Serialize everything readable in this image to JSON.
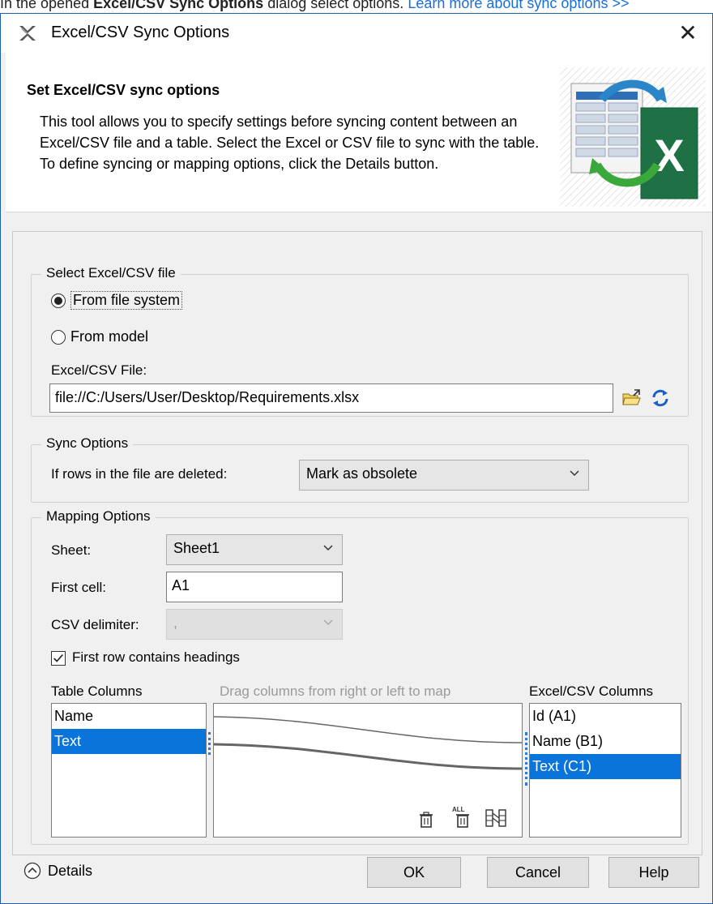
{
  "doc_line": {
    "prefix": "In the opened ",
    "bold": "Excel/CSV Sync Options",
    "middle": " dialog select options. ",
    "link": "Learn more about sync options >>"
  },
  "window": {
    "title": "Excel/CSV Sync Options"
  },
  "header": {
    "title": "Set Excel/CSV sync options",
    "description": "This tool allows you to specify settings before syncing content between an Excel/CSV file and a table. Select the Excel or CSV file to sync with the table. To define syncing or mapping options, click the Details button."
  },
  "select_file": {
    "legend": "Select Excel/CSV file",
    "option_file_system": "From file system",
    "option_model": "From model",
    "selected": "From file system",
    "file_label": "Excel/CSV File:",
    "file_value": "file://C:/Users/User/Desktop/Requirements.xlsx"
  },
  "sync_options": {
    "legend": "Sync Options",
    "rows_deleted_label": "If rows in the file are deleted:",
    "rows_deleted_value": "Mark as obsolete"
  },
  "mapping_options": {
    "legend": "Mapping Options",
    "sheet_label": "Sheet:",
    "sheet_value": "Sheet1",
    "first_cell_label": "First cell:",
    "first_cell_value": "A1",
    "csv_delimiter_label": "CSV delimiter:",
    "csv_delimiter_value": ",",
    "first_row_headings_label": "First row contains headings",
    "first_row_headings_checked": true,
    "table_columns_header": "Table Columns",
    "drag_hint": "Drag columns from right or left to map",
    "excel_columns_header": "Excel/CSV Columns",
    "table_columns": [
      "Name",
      "Text"
    ],
    "table_columns_selected": "Text",
    "excel_columns": [
      "Id (A1)",
      "Name (B1)",
      "Text (C1)"
    ],
    "excel_columns_selected": "Text (C1)",
    "mappings": [
      {
        "table": "Name",
        "excel": "Name (B1)"
      },
      {
        "table": "Text",
        "excel": "Text (C1)"
      }
    ],
    "tool_icons": [
      "trash-icon",
      "trash-all-icon",
      "auto-map-icon"
    ]
  },
  "footer": {
    "details_label": "Details",
    "ok_label": "OK",
    "cancel_label": "Cancel",
    "help_label": "Help"
  },
  "colors": {
    "selection": "#0a74da",
    "link": "#1a6fd6",
    "excel_green": "#1e7145",
    "refresh_blue": "#1a5fc8"
  }
}
